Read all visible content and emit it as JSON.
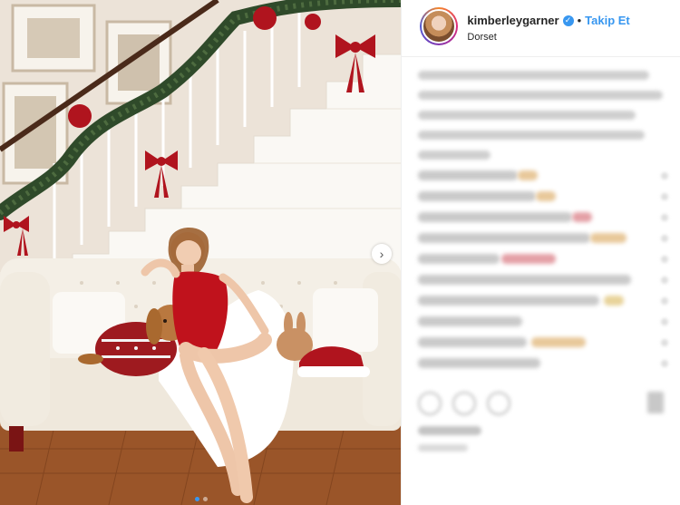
{
  "header": {
    "username": "kimberleygarner",
    "follow_label": "Takip Et",
    "separator": "•",
    "location": "Dorset",
    "verified_icon": "verified-badge-icon"
  },
  "carousel": {
    "next_icon": "chevron-right-icon",
    "next_glyph": "›",
    "slide_count": 2,
    "active_slide": 1
  },
  "colors": {
    "accent": "#3897f0",
    "text": "#262626",
    "ribbon": "#b0141e",
    "garland": "#2f4a2a"
  }
}
